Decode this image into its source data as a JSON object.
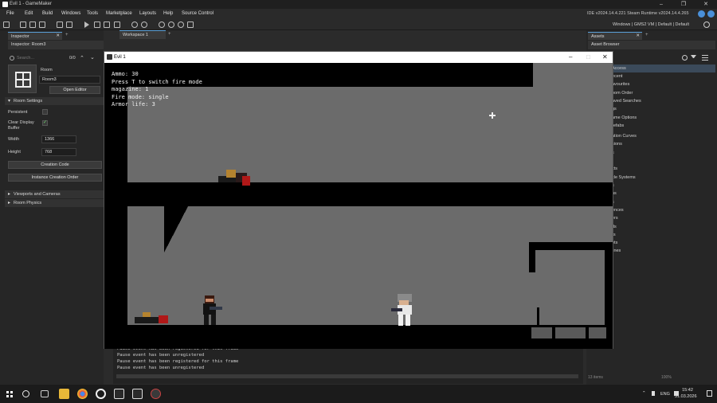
{
  "window": {
    "title": "Evil 1 - GameMaker"
  },
  "menu": [
    "File",
    "Edit",
    "Build",
    "Windows",
    "Tools",
    "Marketplace",
    "Layouts",
    "Help",
    "Source Control"
  ],
  "ide_version": "IDE v2024.14.4.221 Steam  Runtime v2024.14.4.265",
  "targets": "Windows  |  GMS2 VM  |  Default  |  Default",
  "inspector": {
    "tab": "Inspector",
    "subtitle": "Inspector: Room3",
    "search_placeholder": "Search...",
    "count": "0/0",
    "asset_type": "Room",
    "asset_name": "Room3",
    "open_editor": "Open Editor",
    "room_settings": "Room Settings",
    "persistent": "Persistent",
    "clear_display": "Clear Display Buffer",
    "width_label": "Width",
    "width_value": "1366",
    "height_label": "Height",
    "height_value": "768",
    "creation_code": "Creation Code",
    "instance_order": "Instance Creation Order",
    "viewports": "Viewports and Cameras",
    "physics": "Room Physics"
  },
  "workspace": {
    "tab": "Workspace 1"
  },
  "assets": {
    "tab": "Assets",
    "subtitle": "Asset Browser",
    "items": [
      "Access",
      "ecent",
      "avourites",
      "oom Order",
      "aved Searches",
      "gs",
      "ame Options",
      "refabs",
      "ation Curves",
      "sions",
      "s",
      "cts",
      "cle Systems",
      "s",
      "ns",
      "s",
      "ences",
      "ers",
      "rs",
      "ds",
      "rs",
      "ets",
      "lines"
    ],
    "item_count": "13 items",
    "zoom": "100%"
  },
  "game": {
    "title": "Evil 1",
    "hud": [
      "Ammo: 30",
      "Press T to switch fire mode",
      "magazine: 1",
      "Fire mode: single",
      "Armor life: 3"
    ]
  },
  "output": [
    "Pause event has been registered for this frame",
    "Pause event has been unregistered",
    "Pause event has been registered for this frame",
    "Pause event has been unregistered"
  ],
  "taskbar": {
    "lang": "ENG",
    "time": "15:42",
    "date": "31.03.2026"
  }
}
